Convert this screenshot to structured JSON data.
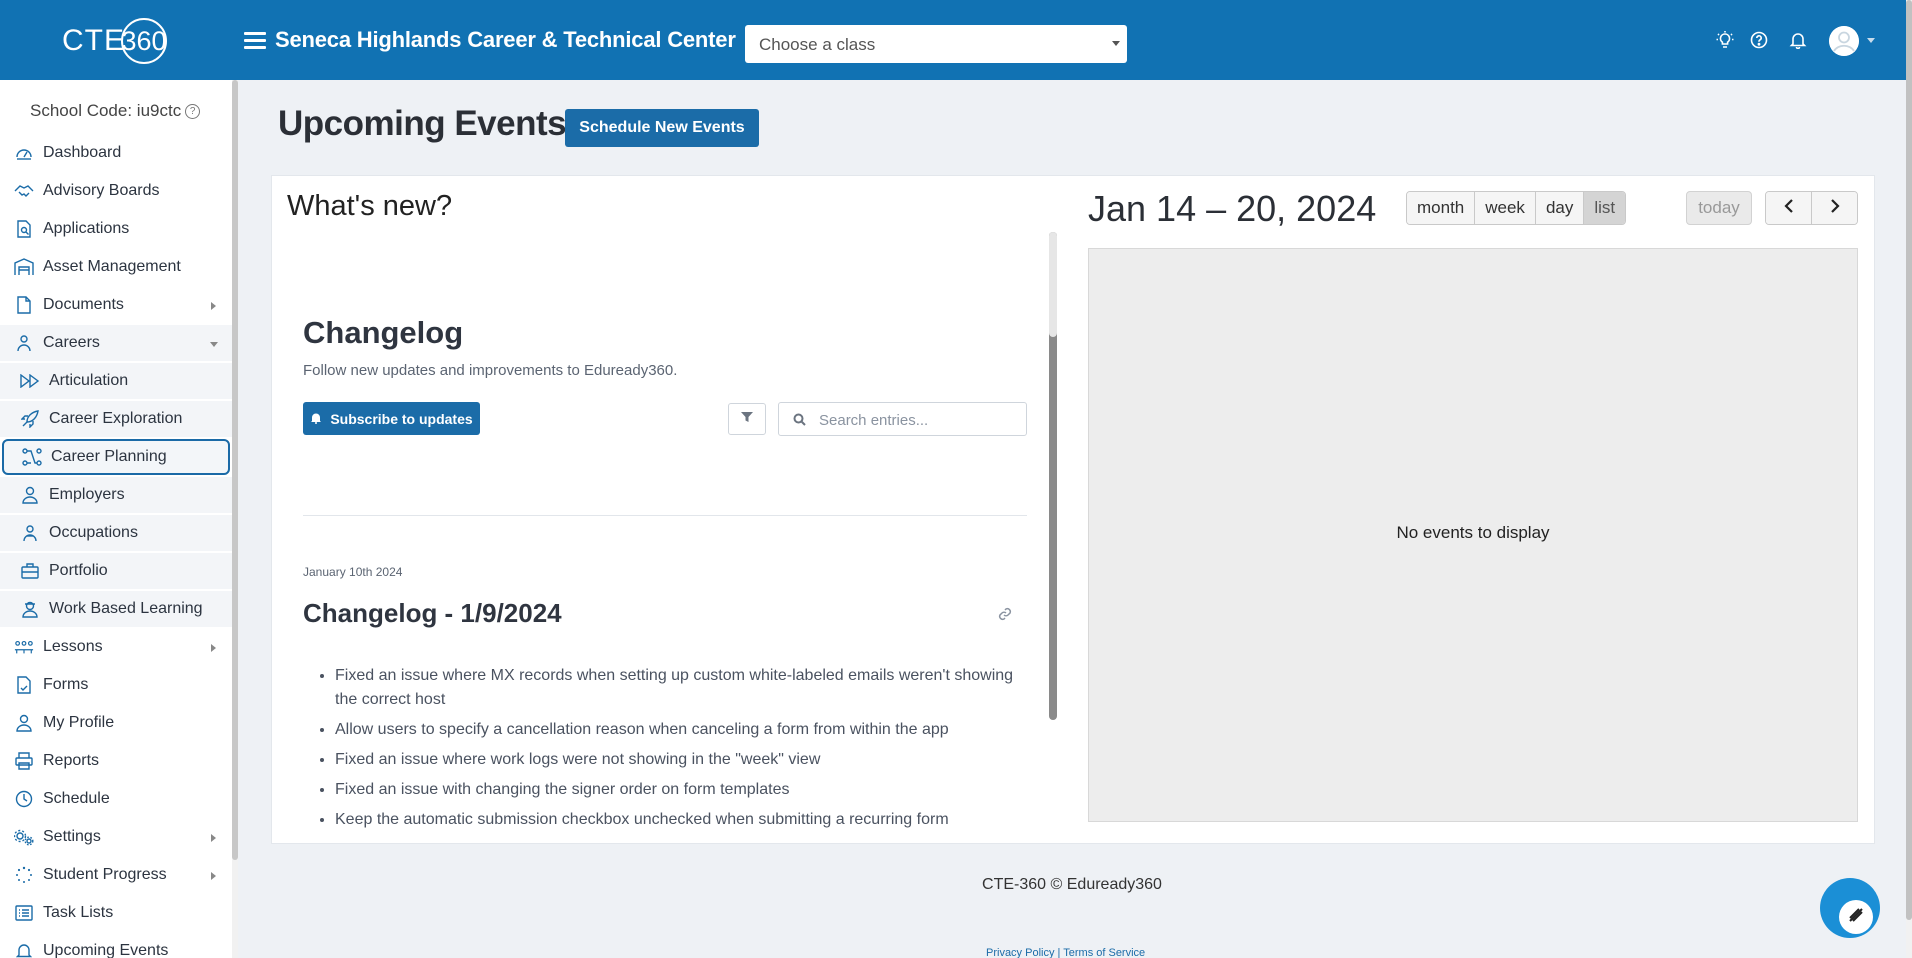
{
  "header": {
    "logo_text": "CTE",
    "logo_ring_text": "360",
    "org_title": "Seneca Highlands Career & Technical Center",
    "class_select_placeholder": "Choose a class",
    "icons": [
      "lightbulb-icon",
      "help-icon",
      "bell-icon",
      "user-avatar"
    ]
  },
  "sidebar": {
    "school_code": "School Code: iu9ctc",
    "items": [
      {
        "label": "Dashboard",
        "icon": "gauge-icon"
      },
      {
        "label": "Advisory Boards",
        "icon": "handshake-icon"
      },
      {
        "label": "Applications",
        "icon": "file-search-icon"
      },
      {
        "label": "Asset Management",
        "icon": "warehouse-icon"
      },
      {
        "label": "Documents",
        "icon": "document-icon"
      },
      {
        "label": "Careers",
        "icon": "people-icon"
      },
      {
        "label": "Articulation",
        "icon": "forward-icon"
      },
      {
        "label": "Career Exploration",
        "icon": "rocket-icon"
      },
      {
        "label": "Career Planning",
        "icon": "route-icon"
      },
      {
        "label": "Employers",
        "icon": "user-tie-icon"
      },
      {
        "label": "Occupations",
        "icon": "people-group-icon"
      },
      {
        "label": "Portfolio",
        "icon": "briefcase-icon"
      },
      {
        "label": "Work Based Learning",
        "icon": "worker-icon"
      },
      {
        "label": "Lessons",
        "icon": "classroom-icon"
      },
      {
        "label": "Forms",
        "icon": "form-icon"
      },
      {
        "label": "My Profile",
        "icon": "user-icon"
      },
      {
        "label": "Reports",
        "icon": "printer-icon"
      },
      {
        "label": "Schedule",
        "icon": "clock-icon"
      },
      {
        "label": "Settings",
        "icon": "gears-icon"
      },
      {
        "label": "Student Progress",
        "icon": "spinner-icon"
      },
      {
        "label": "Task Lists",
        "icon": "list-icon"
      },
      {
        "label": "Upcoming Events",
        "icon": "bell-icon"
      }
    ]
  },
  "main": {
    "page_title": "Upcoming Events",
    "schedule_button": "Schedule New Events",
    "whats_new_title": "What's new?"
  },
  "changelog": {
    "title": "Changelog",
    "subtitle": "Follow new updates and improvements to Eduready360.",
    "subscribe_label": "Subscribe to updates",
    "search_placeholder": "Search entries...",
    "entry": {
      "date": "January 10th 2024",
      "title": "Changelog - 1/9/2024",
      "items": [
        "Fixed an issue where MX records when setting up custom white-labeled emails weren't showing the correct host",
        "Allow users to specify a cancellation reason when canceling a form from within the app",
        "Fixed an issue where work logs were not showing in the \"week\" view",
        "Fixed an issue with changing the signer order on form templates",
        "Keep the automatic submission checkbox unchecked when submitting a recurring form"
      ]
    }
  },
  "calendar": {
    "range_title": "Jan 14 – 20, 2024",
    "views": [
      "month",
      "week",
      "day",
      "list"
    ],
    "active_view": "list",
    "today_label": "today",
    "empty_text": "No events to display"
  },
  "footer": {
    "copyright": "CTE-360 © Eduready360",
    "privacy": "Privacy Policy",
    "separator": "|",
    "terms": "Terms of Service"
  }
}
